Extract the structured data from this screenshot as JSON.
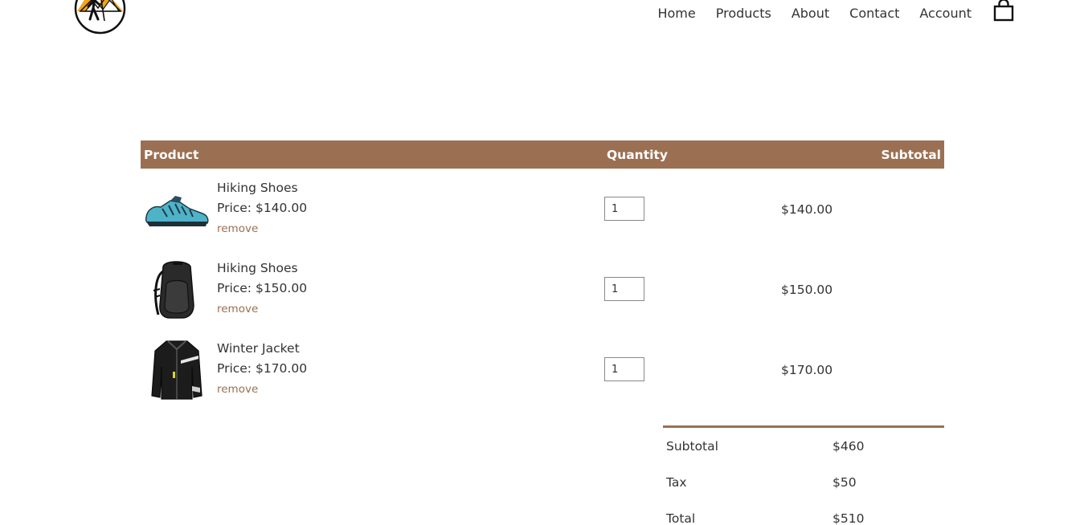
{
  "nav": {
    "links": [
      "Home",
      "Products",
      "About",
      "Contact",
      "Account"
    ],
    "cart_icon": "shopping-bag-icon",
    "logo_icon": "hiker-mountain-logo"
  },
  "table": {
    "headers": {
      "product": "Product",
      "quantity": "Quantity",
      "subtotal": "Subtotal"
    },
    "rows": [
      {
        "name": "Hiking Shoes",
        "price": "Price: $140.00",
        "remove": "remove",
        "quantity": "1",
        "subtotal": "$140.00",
        "image": "hiking-shoe-image"
      },
      {
        "name": "Hiking Shoes",
        "price": "Price: $150.00",
        "remove": "remove",
        "quantity": "1",
        "subtotal": "$150.00",
        "image": "backpack-image"
      },
      {
        "name": "Winter Jacket",
        "price": "Price: $170.00",
        "remove": "remove",
        "quantity": "1",
        "subtotal": "$170.00",
        "image": "winter-jacket-image"
      }
    ]
  },
  "totals": {
    "subtotal_label": "Subtotal",
    "subtotal_value": "$460",
    "tax_label": "Tax",
    "tax_value": "$50",
    "total_label": "Total",
    "total_value": "$510"
  },
  "colors": {
    "accent": "#9b7052",
    "logo_orange": "#f4a31a"
  }
}
